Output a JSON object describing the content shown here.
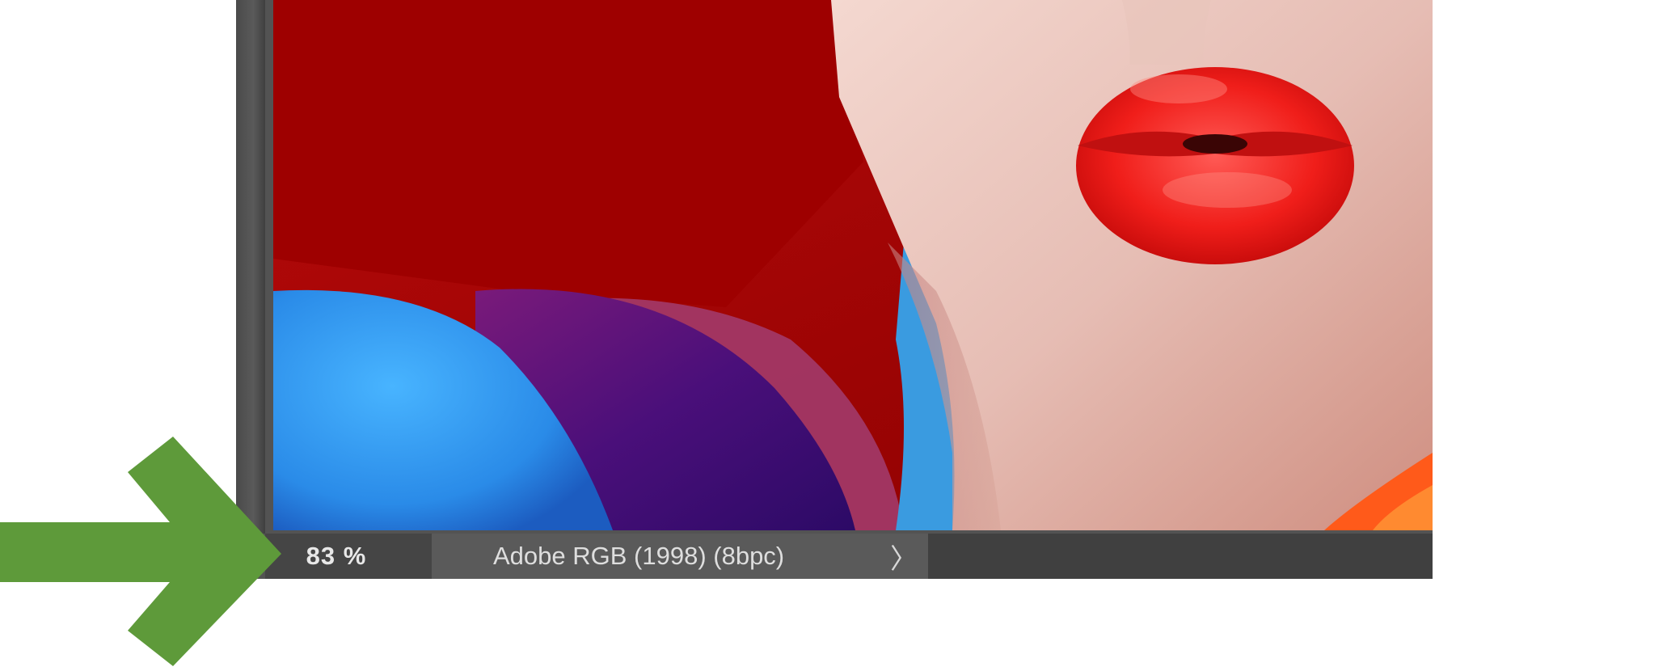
{
  "status_bar": {
    "zoom_level": "83 %",
    "document_profile": "Adobe RGB (1998) (8bpc)",
    "expand_glyph": "〉"
  },
  "colors": {
    "annotation_arrow": "#5e9a3a",
    "status_bar_bg": "#454545",
    "doc_info_bg": "#5a5a5a",
    "panel_bg": "#535353"
  },
  "icons": {
    "expand": "chevron-right-icon",
    "annotation": "arrow-right-icon"
  }
}
